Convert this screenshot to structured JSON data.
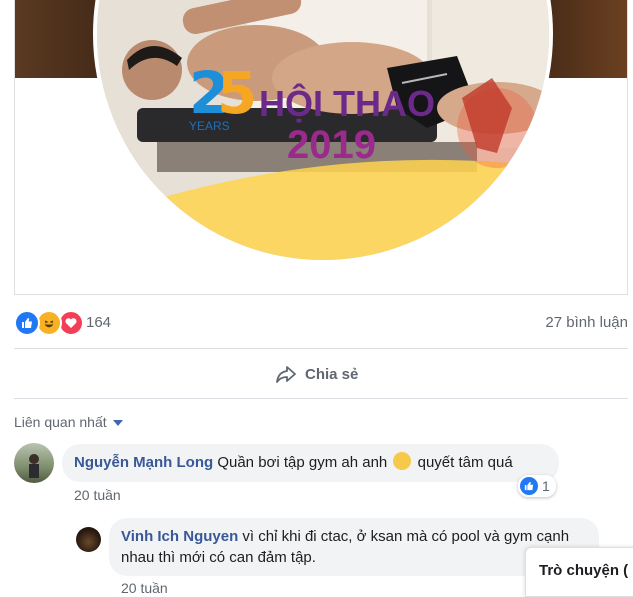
{
  "post": {
    "image": {
      "logo_years": "YEARS",
      "logo_title": "HỘI THAO",
      "logo_year": "2019"
    },
    "reactions_count": "164",
    "comments_count": "27 bình luận",
    "share_label": "Chia sẻ",
    "sort_label": "Liên quan nhất"
  },
  "comments": [
    {
      "author": "Nguyễn Mạnh Long",
      "text": "Quần bơi tập gym ah anh",
      "text_after": "quyết tâm quá",
      "time": "20 tuần",
      "likes": "1"
    },
    {
      "author": "Vinh Ich Nguyen",
      "text": "vì chỉ khi đi ctac, ở ksan mà có pool và gym cạnh nhau thì mới có can đảm tập.",
      "time": "20 tuần"
    }
  ],
  "chat": {
    "label": "Trò chuyện ("
  },
  "colors": {
    "link": "#385898",
    "like": "#2078f4",
    "love": "#f33e58",
    "haha": "#f7b125"
  }
}
